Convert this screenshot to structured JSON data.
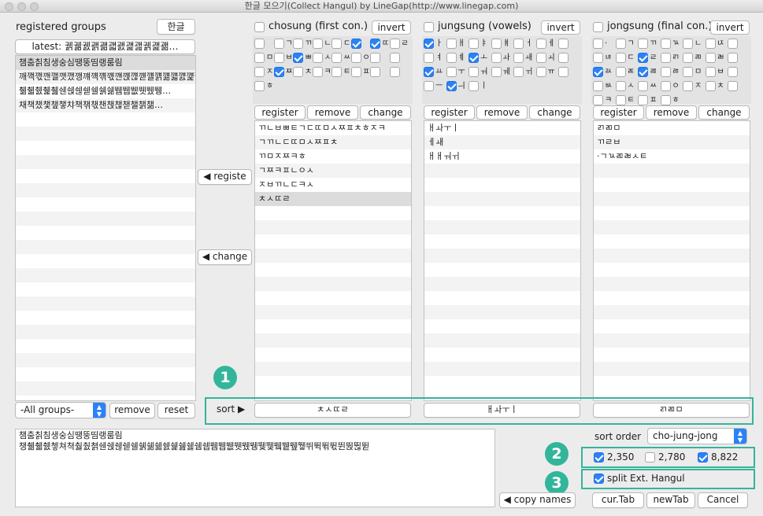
{
  "window": {
    "title": "한글 모으기(Collect Hangul) by LineGap(http://www.linegap.com)"
  },
  "groups": {
    "title": "registered groups",
    "hangul_button": "한글",
    "latest_label": "latest: 궭궮궰괡괢괣괤괥괦궭괥괢…",
    "items": [
      "챔춤칡침생숭심땡뚱띰랭룸림",
      "깨깩깫깬깰깻깼깽꺠꺡꺢꺣꺤꺥꺦꺧꺨꺩꺪꺫꺬꺭꺮꺯꺰꺱…",
      "췖췗췘췙췚쉔쉕쉖쉗쉘쉙쉚뛤뛥뛦뛧뛨뛩…",
      "채책챘챛챞챟챠책챆챇챈챉챊챋챌챍챎…"
    ],
    "filter_select": "-All groups-",
    "remove_button": "remove",
    "reset_button": "reset"
  },
  "middle": {
    "register_button": "◀ registe",
    "change_button": "◀ change"
  },
  "columns": [
    {
      "title": "chosung (first con.)",
      "invert": "invert",
      "jamo": [
        {
          "c": "",
          "on": false
        },
        {
          "c": "ㄱ",
          "on": false
        },
        {
          "c": "ㄲ",
          "on": false
        },
        {
          "c": "ㄴ",
          "on": false
        },
        {
          "c": "ㄷ",
          "on": false
        },
        {
          "c": "",
          "on": true
        },
        {
          "c": "ㄸ",
          "on": true
        },
        {
          "c": "ㄹ",
          "on": false
        },
        {
          "c": "ㅁ",
          "on": false
        },
        {
          "c": "ㅂ",
          "on": false
        },
        {
          "c": "ㅃ",
          "on": true
        },
        {
          "c": "ㅅ",
          "on": false
        },
        {
          "c": "ㅆ",
          "on": false
        },
        {
          "c": "ㅇ",
          "on": false
        },
        {
          "c": "",
          "on": false
        },
        {
          "c": "",
          "on": false
        },
        {
          "c": "ㅈ",
          "on": false
        },
        {
          "c": "ㅉ",
          "on": true
        },
        {
          "c": "ㅊ",
          "on": false
        },
        {
          "c": "ㅋ",
          "on": false
        },
        {
          "c": "ㅌ",
          "on": false
        },
        {
          "c": "ㅍ",
          "on": false
        },
        {
          "c": "",
          "on": false
        },
        {
          "c": "",
          "on": false
        },
        {
          "c": "ㅎ",
          "on": false
        }
      ],
      "register": "register",
      "remove": "remove",
      "change": "change",
      "list": [
        "ㄲㄴㅂㅃㅌㄱㄷㄸㅁㅅㅉㅍㅊㅎㅈㅋ",
        "ㄱㄲㄴㄷㄸㅁㅅㅉㅍㅊ",
        "ㄲㅁㅈㅉㅋㅎ",
        "ㄱㅉㅋㅍㄴㅇㅅ",
        "ㅈㅂㄲㄴㄷㅋㅅ",
        "ㅊㅅㄸㄹ"
      ],
      "sort_value": "ㅊㅅㄸㄹ"
    },
    {
      "title": "jungsung (vowels)",
      "invert": "invert",
      "jamo": [
        {
          "c": "ㅏ",
          "on": true
        },
        {
          "c": "ㅐ",
          "on": false
        },
        {
          "c": "ㅑ",
          "on": false
        },
        {
          "c": "ㅒ",
          "on": false
        },
        {
          "c": "ㅓ",
          "on": false
        },
        {
          "c": "ㅔ",
          "on": false
        },
        {
          "c": "",
          "on": false
        },
        {
          "c": "ㅕ",
          "on": false
        },
        {
          "c": "ㅖ",
          "on": false
        },
        {
          "c": "ㅗ",
          "on": true
        },
        {
          "c": "ㅘ",
          "on": false
        },
        {
          "c": "ㅙ",
          "on": false
        },
        {
          "c": "ㅚ",
          "on": false
        },
        {
          "c": "",
          "on": false
        },
        {
          "c": "ㅛ",
          "on": true
        },
        {
          "c": "ㅜ",
          "on": false
        },
        {
          "c": "ㅝ",
          "on": false
        },
        {
          "c": "ㅞ",
          "on": false
        },
        {
          "c": "ㅟ",
          "on": false
        },
        {
          "c": "ㅠ",
          "on": false
        },
        {
          "c": "",
          "on": false
        },
        {
          "c": "ㅡ",
          "on": false
        },
        {
          "c": "ㅢ",
          "on": true
        },
        {
          "c": "ㅣ",
          "on": false
        }
      ],
      "register": "register",
      "remove": "remove",
      "change": "change",
      "list": [
        "ㅐㅘㅜㅣ",
        "ㅔㅙ",
        "ㅐㅐㅝㅟ"
      ],
      "sort_value": "ㅐㅘㅜㅣ"
    },
    {
      "title": "jongsung (final con.)",
      "invert": "invert",
      "jamo": [
        {
          "c": "·",
          "on": false
        },
        {
          "c": "ㄱ",
          "on": false
        },
        {
          "c": "ㄲ",
          "on": false
        },
        {
          "c": "ㄳ",
          "on": false
        },
        {
          "c": "ㄴ",
          "on": false
        },
        {
          "c": "ㄵ",
          "on": false
        },
        {
          "c": "",
          "on": false
        },
        {
          "c": "ㄶ",
          "on": false
        },
        {
          "c": "ㄷ",
          "on": false
        },
        {
          "c": "ㄹ",
          "on": true
        },
        {
          "c": "ㄺ",
          "on": false
        },
        {
          "c": "ㄻ",
          "on": false
        },
        {
          "c": "ㄼ",
          "on": false
        },
        {
          "c": "",
          "on": false
        },
        {
          "c": "ㄽ",
          "on": true
        },
        {
          "c": "ㄾ",
          "on": false
        },
        {
          "c": "ㄿ",
          "on": true
        },
        {
          "c": "ㅀ",
          "on": false
        },
        {
          "c": "ㅁ",
          "on": false
        },
        {
          "c": "ㅂ",
          "on": false
        },
        {
          "c": "",
          "on": false
        },
        {
          "c": "ㅄ",
          "on": false
        },
        {
          "c": "ㅅ",
          "on": false
        },
        {
          "c": "ㅆ",
          "on": false
        },
        {
          "c": "ㅇ",
          "on": false
        },
        {
          "c": "ㅈ",
          "on": false
        },
        {
          "c": "ㅊ",
          "on": false
        },
        {
          "c": "",
          "on": false
        },
        {
          "c": "ㅋ",
          "on": false
        },
        {
          "c": "ㅌ",
          "on": false
        },
        {
          "c": "ㅍ",
          "on": false
        },
        {
          "c": "ㅎ",
          "on": false
        }
      ],
      "register": "register",
      "remove": "remove",
      "change": "change",
      "list": [
        "ㄺㄻㅁ",
        "ㄲㄹㅂ",
        "·ㄱㄳㄻㄼㅅㅌ"
      ],
      "sort_value": "ㄺㄻㅁ"
    }
  ],
  "sort_label": "sort ▶",
  "result_text": [
    "챔춤칡침생숭심땡뚱띰랭룸림",
    "챙췖췗췘쳏쳐쳑춿춼쳙쉔쉕쉖쉗쉘쉙쉚쉛쉜쉝쉞쉟쉠쉡뛤뛥뛦뛧뛨뛩뛪뛫뛬뛭뛮뛯뛰뛱뛲뛳뛴뛵뛶뛷"
  ],
  "sort_order": {
    "label": "sort order",
    "value": "cho-jung-jong"
  },
  "counts": [
    {
      "label": "2,350",
      "on": true
    },
    {
      "label": "2,780",
      "on": false
    },
    {
      "label": "8,822",
      "on": true
    }
  ],
  "split": {
    "label": "split Ext. Hangul",
    "on": true
  },
  "buttons": {
    "copy_names": "◀ copy names",
    "cur_tab": "cur.Tab",
    "new_tab": "newTab",
    "cancel": "Cancel"
  },
  "badges": [
    "1",
    "2",
    "3"
  ],
  "accent_color": "#33b59b",
  "check_color": "#2a82f6"
}
